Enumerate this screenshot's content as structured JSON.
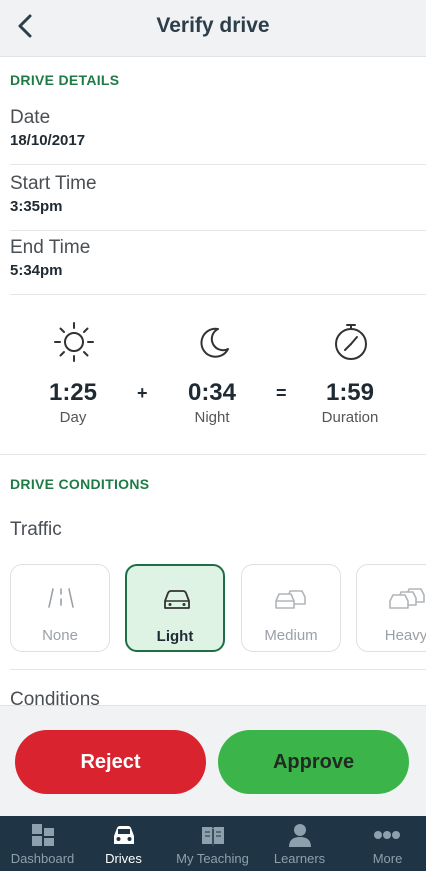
{
  "header": {
    "title": "Verify drive",
    "back_icon": "chevron-left-icon"
  },
  "drive_details": {
    "heading": "DRIVE DETAILS",
    "date": {
      "label": "Date",
      "value": "18/10/2017"
    },
    "start_time": {
      "label": "Start Time",
      "value": "3:35pm"
    },
    "end_time": {
      "label": "End Time",
      "value": "5:34pm"
    }
  },
  "time_summary": {
    "day": {
      "value": "1:25",
      "label": "Day",
      "icon": "sun-icon"
    },
    "plus": "+",
    "night": {
      "value": "0:34",
      "label": "Night",
      "icon": "moon-icon"
    },
    "equals": "=",
    "duration": {
      "value": "1:59",
      "label": "Duration",
      "icon": "stopwatch-icon"
    }
  },
  "drive_conditions": {
    "heading": "DRIVE CONDITIONS",
    "traffic_label": "Traffic",
    "traffic_options": [
      {
        "label": "None",
        "icon": "empty-road-icon",
        "selected": false
      },
      {
        "label": "Light",
        "icon": "car-icon",
        "selected": true
      },
      {
        "label": "Medium",
        "icon": "two-cars-icon",
        "selected": false
      },
      {
        "label": "Heavy",
        "icon": "three-cars-icon",
        "selected": false
      }
    ],
    "conditions_label": "Conditions"
  },
  "actions": {
    "reject_label": "Reject",
    "approve_label": "Approve"
  },
  "colors": {
    "accent_green": "#1e7b45",
    "reject_red": "#d9232e",
    "approve_green": "#3bb54a",
    "tabbar_bg": "#1f3444"
  },
  "tabbar": {
    "items": [
      {
        "label": "Dashboard",
        "icon": "dashboard-icon",
        "active": false
      },
      {
        "label": "Drives",
        "icon": "car-icon",
        "active": true
      },
      {
        "label": "My Teaching",
        "icon": "book-icon",
        "active": false
      },
      {
        "label": "Learners",
        "icon": "person-icon",
        "active": false
      },
      {
        "label": "More",
        "icon": "more-dots-icon",
        "active": false
      }
    ]
  }
}
